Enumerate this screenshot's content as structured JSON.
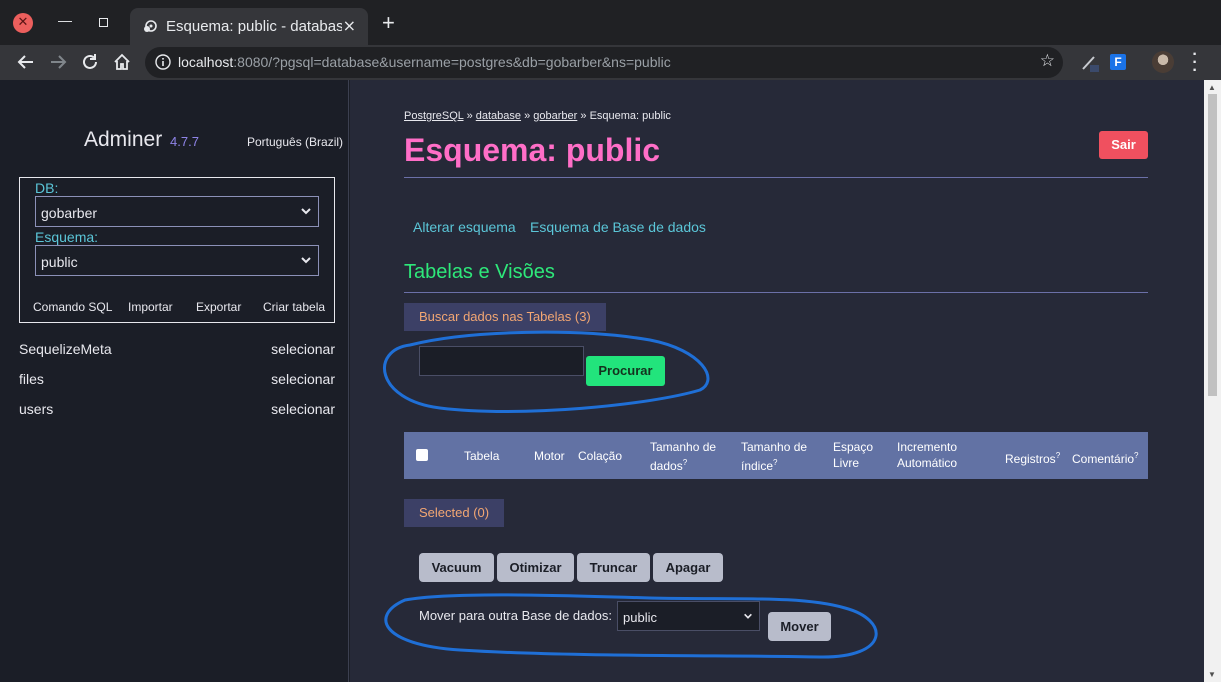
{
  "browser": {
    "tab_title": "Esquema: public - database",
    "url_host": "localhost",
    "url_rest": ":8080/?pgsql=database&username=postgres&db=gobarber&ns=public",
    "new_tab_symbol": "+",
    "close_symbol": "×",
    "star_symbol": "☆",
    "ext_label": "F"
  },
  "sidebar": {
    "app_name": "Adminer",
    "version": "4.7.7",
    "language": "Português (Brazil)",
    "db_label": "DB:",
    "db_value": "gobarber",
    "schema_label": "Esquema:",
    "schema_value": "public",
    "links": [
      "Comando SQL",
      "Importar",
      "Exportar",
      "Criar tabela"
    ],
    "tables": [
      {
        "name": "SequelizeMeta",
        "action": "selecionar"
      },
      {
        "name": "files",
        "action": "selecionar"
      },
      {
        "name": "users",
        "action": "selecionar"
      }
    ]
  },
  "main": {
    "breadcrumb": {
      "items": [
        "PostgreSQL",
        "database",
        "gobarber"
      ],
      "sep": "»",
      "current": "Esquema: public"
    },
    "title": "Esquema: public",
    "logout_label": "Sair",
    "links": [
      "Alterar esquema",
      "Esquema de Base de dados"
    ],
    "section_title": "Tabelas e Visões",
    "search_tab_label": "Buscar dados nas Tabelas (3)",
    "search_button": "Procurar",
    "table_headers": [
      {
        "l1": "Tabela",
        "l2": ""
      },
      {
        "l1": "Motor",
        "l2": ""
      },
      {
        "l1": "Colação",
        "l2": ""
      },
      {
        "l1": "Tamanho de",
        "l2": "dados",
        "sup": "?"
      },
      {
        "l1": "Tamanho de",
        "l2": "índice",
        "sup": "?"
      },
      {
        "l1": "Espaço",
        "l2": "Livre"
      },
      {
        "l1": "Incremento",
        "l2": "Automático"
      },
      {
        "l1": "Registros",
        "l2": "",
        "sup": "?"
      },
      {
        "l1": "Comentário",
        "l2": "",
        "sup": "?"
      }
    ],
    "selected_label": "Selected (0)",
    "actions": [
      "Vacuum",
      "Otimizar",
      "Truncar",
      "Apagar"
    ],
    "move_label": "Mover para outra Base de dados:",
    "move_select_value": "public",
    "move_button": "Mover"
  },
  "colors": {
    "title_pink": "#ff6ec7",
    "section_green": "#2ee87a",
    "link_cyan": "#5bc6d8",
    "annotation_blue": "#1f6fd6"
  }
}
